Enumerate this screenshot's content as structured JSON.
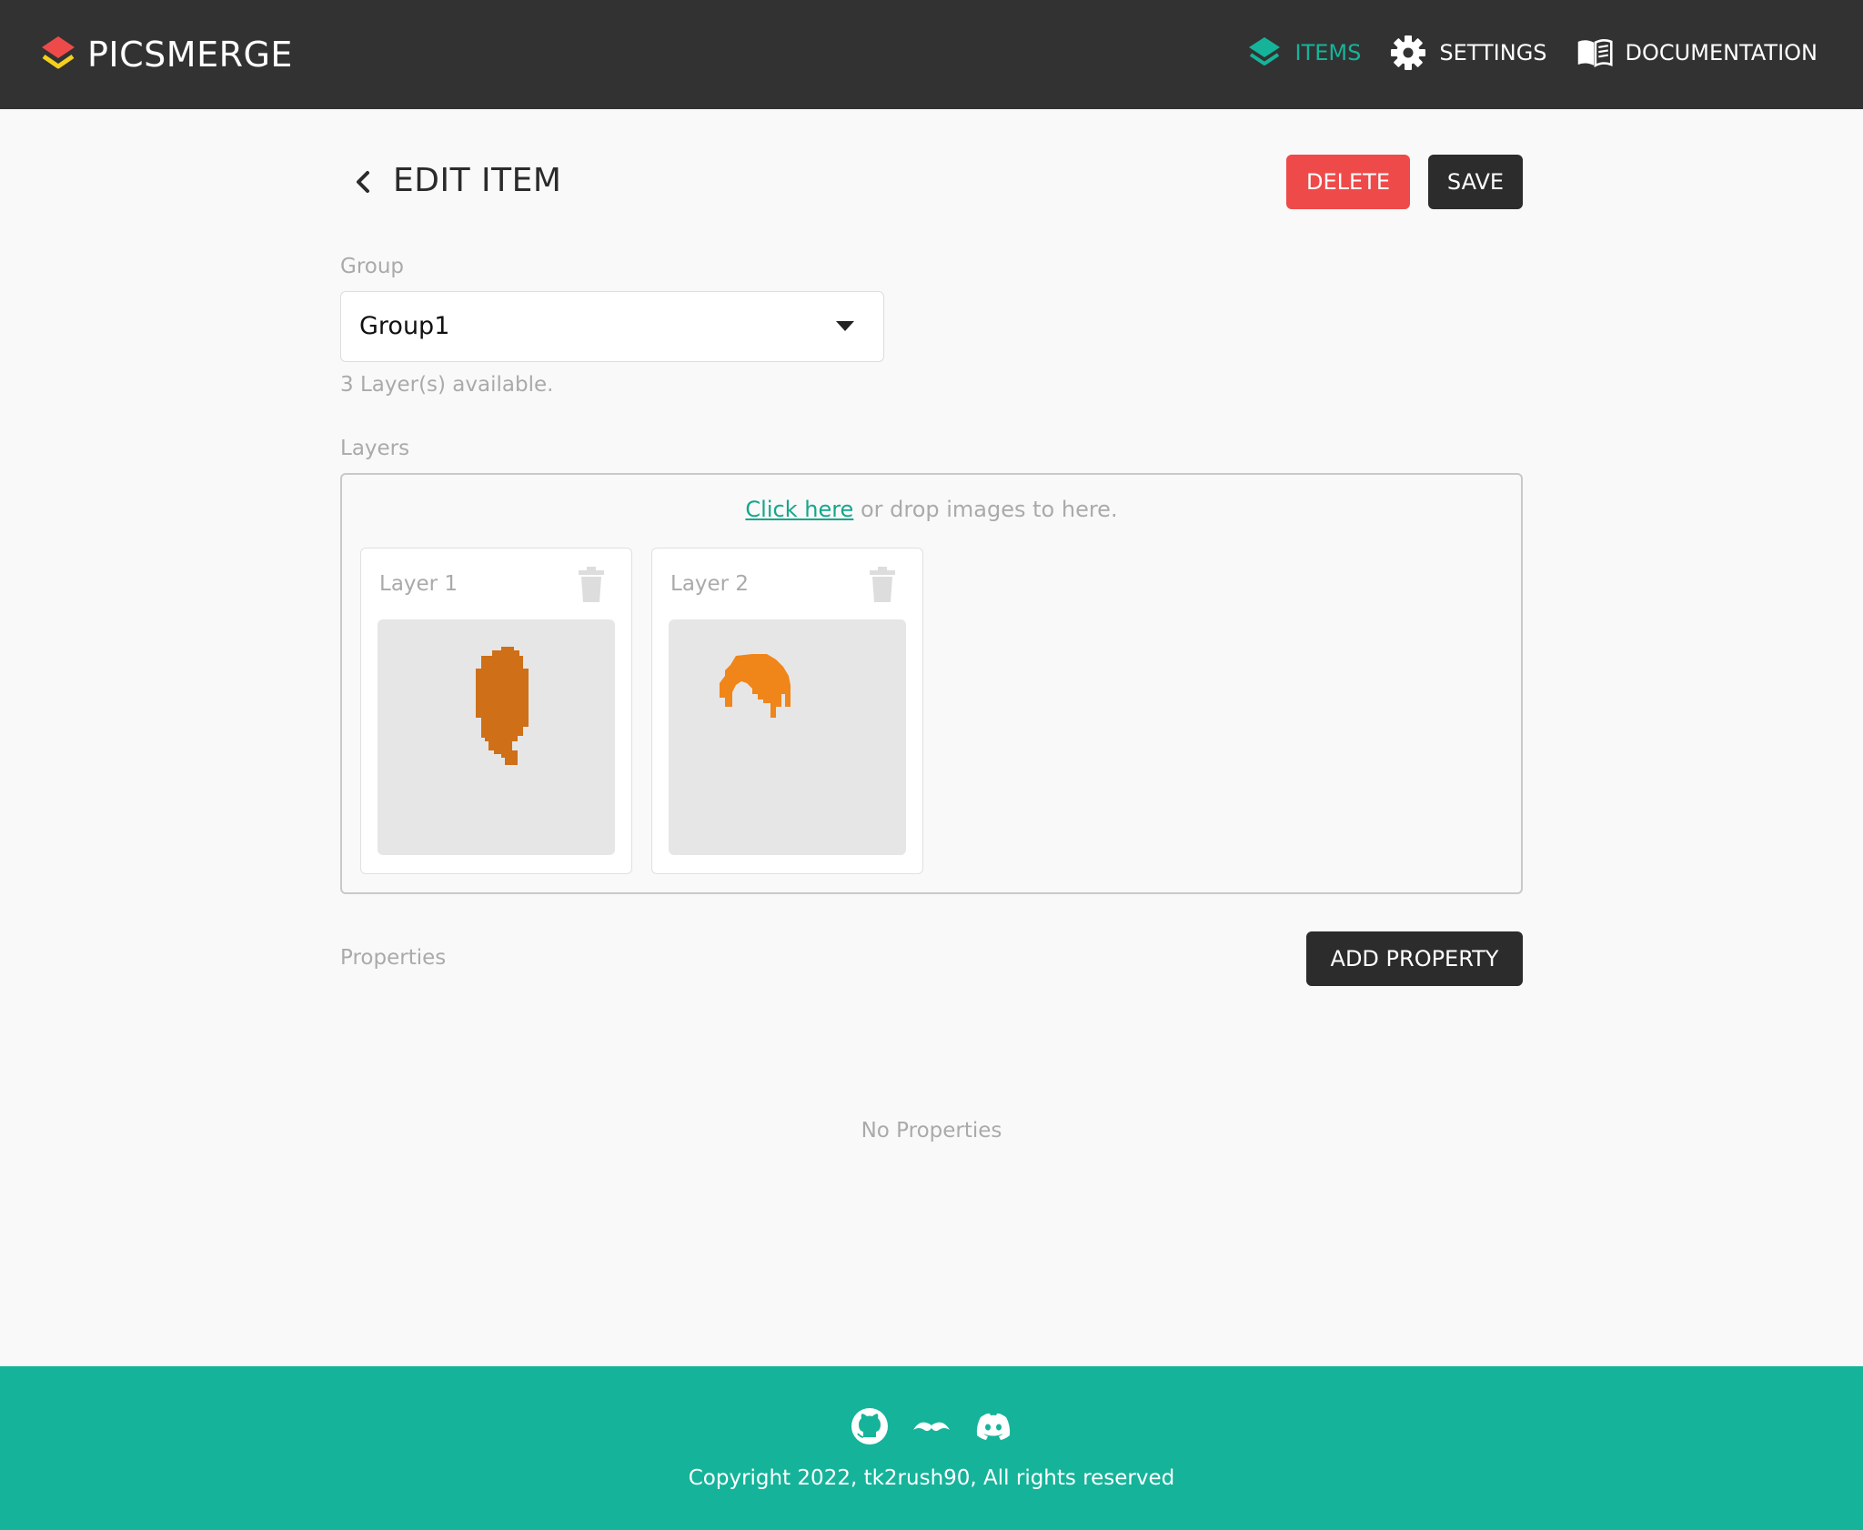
{
  "brand": {
    "name": "PICSMERGE",
    "logo_icon": "layers-logo-icon"
  },
  "nav": {
    "items_label": "ITEMS",
    "settings_label": "SETTINGS",
    "documentation_label": "DOCUMENTATION"
  },
  "page": {
    "title": "EDIT ITEM",
    "delete_label": "DELETE",
    "save_label": "SAVE"
  },
  "group": {
    "label": "Group",
    "selected": "Group1",
    "hint": "3 Layer(s) available."
  },
  "layers": {
    "label": "Layers",
    "drop_link": "Click here",
    "drop_text": " or drop images to here.",
    "items": [
      {
        "name": "Layer 1"
      },
      {
        "name": "Layer 2"
      }
    ]
  },
  "properties": {
    "label": "Properties",
    "add_label": "ADD PROPERTY",
    "empty_text": "No Properties"
  },
  "footer": {
    "copyright": "Copyright 2022, tk2rush90, All rights reserved",
    "social_icons": [
      "github-icon",
      "mustache-icon",
      "discord-icon"
    ]
  },
  "colors": {
    "header_bg": "#323232",
    "accent": "#15b49a",
    "delete": "#ef4a4a",
    "dark_button": "#2c2c2c",
    "layer1_fill": "#cf6f17",
    "layer2_fill": "#f08519"
  }
}
